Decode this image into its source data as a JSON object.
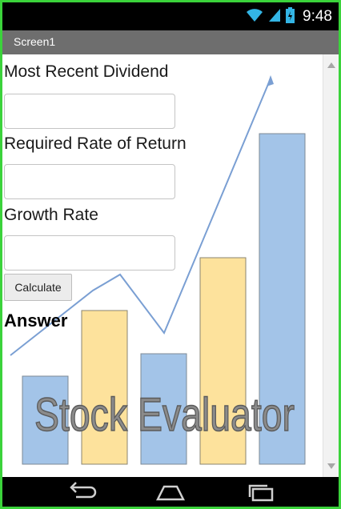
{
  "status_bar": {
    "time": "9:48",
    "icons": [
      "wifi-icon",
      "signal-icon",
      "battery-icon"
    ]
  },
  "title_bar": {
    "title": "Screen1"
  },
  "form": {
    "dividend_label": "Most Recent Dividend",
    "dividend_value": "",
    "rate_label": "Required Rate of Return",
    "rate_value": "",
    "growth_label": "Growth Rate",
    "growth_value": "",
    "calculate_label": "Calculate",
    "answer_label": "Answer"
  },
  "background_logo": {
    "text": "Stock Evaluator",
    "bar_colors": [
      "#a3c4e8",
      "#fde29c",
      "#a3c4e8",
      "#fde29c",
      "#a3c4e8"
    ],
    "trend_color": "#7a9fd3"
  },
  "nav_bar": {
    "icons": [
      "back-icon",
      "home-icon",
      "recents-icon"
    ]
  },
  "colors": {
    "frame": "#3bd33b",
    "title_bar": "#6e6e6e",
    "status_bar": "#000000"
  }
}
